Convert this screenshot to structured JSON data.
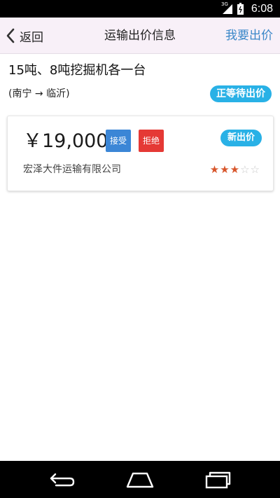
{
  "status_bar": {
    "network": "3G",
    "time": "6:08"
  },
  "header": {
    "back_label": "返回",
    "title": "运输出价信息",
    "action_label": "我要出价"
  },
  "order": {
    "title": "15吨、8吨挖掘机各一台",
    "route": "(南宁 → 临沂)",
    "status": "正等待出价"
  },
  "bid": {
    "price": "￥19,000",
    "accept_label": "接受",
    "reject_label": "拒绝",
    "badge": "新出价",
    "company": "宏泽大件运输有限公司",
    "rating": 3,
    "rating_max": 5
  },
  "colors": {
    "accent": "#29b1e6",
    "link": "#3a87c8",
    "accept": "#3b86d6",
    "reject": "#e53935",
    "star": "#d8562b"
  },
  "nav": {
    "icons": [
      "back-icon",
      "home-icon",
      "recents-icon"
    ]
  }
}
